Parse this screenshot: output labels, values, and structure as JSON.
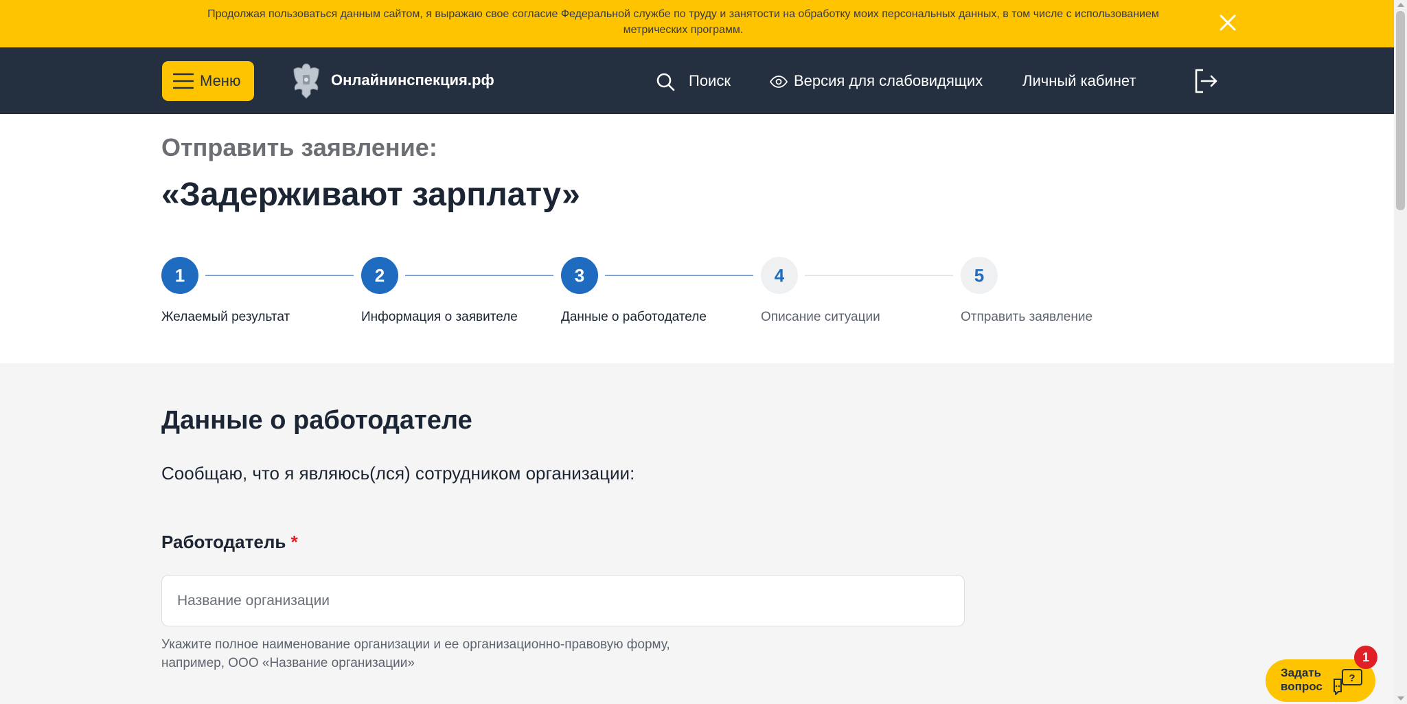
{
  "cookie_banner": {
    "text": "Продолжая пользоваться данным сайтом, я выражаю свое согласие Федеральной службе по труду и занятости на обработку моих персональных данных, в том числе с использованием метрических программ.",
    "close_icon": "close-icon"
  },
  "header": {
    "menu_label": "Меню",
    "site_name": "Онлайнинспекция.рф",
    "search_label": "Поиск",
    "vision_label": "Версия для слабовидящих",
    "cabinet_label": "Личный кабинет",
    "logout_icon": "logout-icon"
  },
  "intro": {
    "subtitle": "Отправить заявление:",
    "title": "«Задерживают зарплату»"
  },
  "stepper": {
    "steps": [
      {
        "number": "1",
        "label": "Желаемый результат",
        "state": "done"
      },
      {
        "number": "2",
        "label": "Информация о заявителе",
        "state": "done"
      },
      {
        "number": "3",
        "label": "Данные о работодателе",
        "state": "done"
      },
      {
        "number": "4",
        "label": "Описание ситуации",
        "state": "todo"
      },
      {
        "number": "5",
        "label": "Отправить заявление",
        "state": "todo"
      }
    ]
  },
  "form": {
    "section_title": "Данные о работодателе",
    "lead": "Сообщаю, что я являюсь(лся) сотрудником организации:",
    "employer_label": "Работодатель",
    "required_mark": "*",
    "employer_placeholder": "Название организации",
    "employer_value": "",
    "employer_hint_line1": "Укажите полное наименование организации и ее организационно-правовую форму,",
    "employer_hint_line2": "например, ООО «Название организации»"
  },
  "ask_widget": {
    "label_line1": "Задать",
    "label_line2": "вопрос",
    "badge_count": "1"
  },
  "colors": {
    "accent_yellow": "#ffc400",
    "header_navy": "#243040",
    "step_blue": "#1f6bbf",
    "required_red": "#e01f26"
  }
}
